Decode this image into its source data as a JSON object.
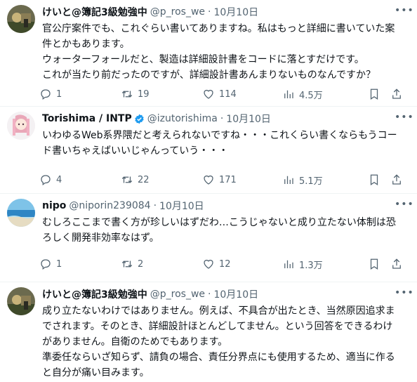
{
  "tweets": [
    {
      "name": "けいと@簿記3級勉強中",
      "handle": "@p_ros_we",
      "separator": "·",
      "date": "10月10日",
      "text": "官公庁案件でも、これぐらい書いてありますね。私はもっと詳細に書いていた案件とかもあります。\nウォーターフォールだと、製造は詳細設計書をコードに落とすだけです。\nこれが当たり前だったのですが、詳細設計書あんまりないものなんですか？",
      "replies": "1",
      "retweets": "19",
      "likes": "114",
      "views": "4.5万"
    },
    {
      "name": "Torishima / INTP",
      "handle": "@izutorishima",
      "separator": "·",
      "date": "10月10日",
      "text": "いわゆるWeb系界隈だと考えられないですね・・・これくらい書くならもうコード書いちゃえばいいじゃんっていう・・・",
      "replies": "4",
      "retweets": "22",
      "likes": "171",
      "views": "5.1万"
    },
    {
      "name": "nipo",
      "handle": "@niporin239084",
      "separator": "·",
      "date": "10月10日",
      "text": "むしろここまで書く方が珍しいはずだわ…こうじゃないと成り立たない体制は恐ろしく開発非効率なはず。",
      "replies": "1",
      "retweets": "2",
      "likes": "12",
      "views": "1.3万"
    },
    {
      "name": "けいと@簿記3級勉強中",
      "handle": "@p_ros_we",
      "separator": "·",
      "date": "10月10日",
      "text": "成り立たないわけではありません。例えば、不具合が出たとき、当然原因追求までされます。そのとき、詳細設計ほとんどしてません。という回答をできるわけがありません。自衛のためでもあります。\n準委任ならいざ知らず、請負の場合、責任分界点にも使用するため、適当に作ると自分が痛い目みます。"
    }
  ],
  "colors": {
    "verified_badge": "#1d9bf0",
    "secondary_text": "#536471",
    "primary_text": "#0f1419"
  }
}
